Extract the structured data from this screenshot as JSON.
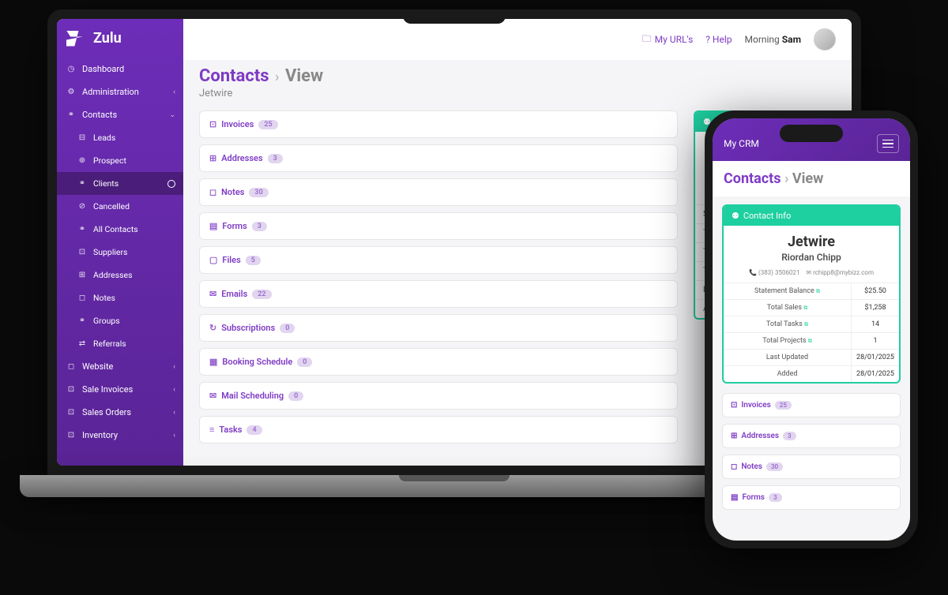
{
  "brand": "Zulu",
  "topbar": {
    "my_urls": "My URL's",
    "help": "? Help",
    "greeting_prefix": "Morning",
    "greeting_name": "Sam"
  },
  "page": {
    "section": "Contacts",
    "view": "View",
    "subtitle": "Jetwire"
  },
  "sidebar": {
    "items": [
      {
        "label": "Dashboard",
        "icon": "◷",
        "type": "main"
      },
      {
        "label": "Administration",
        "icon": "⚙",
        "type": "main",
        "chev": "‹"
      },
      {
        "label": "Contacts",
        "icon": "⚭",
        "type": "main",
        "chev": "⌄",
        "expanded": true
      },
      {
        "label": "Leads",
        "icon": "⊟",
        "type": "sub"
      },
      {
        "label": "Prospect",
        "icon": "⊕",
        "type": "sub"
      },
      {
        "label": "Clients",
        "icon": "⚭",
        "type": "sub",
        "active": true
      },
      {
        "label": "Cancelled",
        "icon": "⊘",
        "type": "sub"
      },
      {
        "label": "All Contacts",
        "icon": "⚭",
        "type": "sub"
      },
      {
        "label": "Suppliers",
        "icon": "⊡",
        "type": "sub"
      },
      {
        "label": "Addresses",
        "icon": "⊞",
        "type": "sub"
      },
      {
        "label": "Notes",
        "icon": "◻",
        "type": "sub"
      },
      {
        "label": "Groups",
        "icon": "⚭",
        "type": "sub"
      },
      {
        "label": "Referrals",
        "icon": "⇄",
        "type": "sub"
      },
      {
        "label": "Website",
        "icon": "◻",
        "type": "main",
        "chev": "‹"
      },
      {
        "label": "Sale Invoices",
        "icon": "⊡",
        "type": "main",
        "chev": "‹"
      },
      {
        "label": "Sales Orders",
        "icon": "⊡",
        "type": "main",
        "chev": "‹"
      },
      {
        "label": "Inventory",
        "icon": "⊡",
        "type": "main",
        "chev": "‹"
      }
    ]
  },
  "panels": [
    {
      "label": "Invoices",
      "count": "25",
      "icon": "⊡"
    },
    {
      "label": "Addresses",
      "count": "3",
      "icon": "⊞"
    },
    {
      "label": "Notes",
      "count": "30",
      "icon": "◻"
    },
    {
      "label": "Forms",
      "count": "3",
      "icon": "▤"
    },
    {
      "label": "Files",
      "count": "5",
      "icon": "▢"
    },
    {
      "label": "Emails",
      "count": "22",
      "icon": "✉"
    },
    {
      "label": "Subscriptions",
      "count": "0",
      "icon": "↻"
    },
    {
      "label": "Booking Schedule",
      "count": "0",
      "icon": "▦"
    },
    {
      "label": "Mail Scheduling",
      "count": "0",
      "icon": "✉"
    },
    {
      "label": "Tasks",
      "count": "4",
      "icon": "≡"
    }
  ],
  "contact_info": {
    "header": "Contact Info",
    "title": "Jetwire",
    "name": "Riordan Chipp",
    "phone": "(383) 3506021",
    "email": "rchipp8@mybizz.com",
    "rows": [
      {
        "label": "Statement Balance",
        "ext": true,
        "value": "$25.50"
      },
      {
        "label": "Total Sales",
        "ext": true,
        "value": "$1,258"
      },
      {
        "label": "Total Tasks",
        "ext": true,
        "value": "14"
      },
      {
        "label": "Total Projects",
        "ext": true,
        "value": "1"
      },
      {
        "label": "Last Updated",
        "ext": false,
        "value": "28/01/2025"
      },
      {
        "label": "Added",
        "ext": false,
        "value": "28/01/2025"
      }
    ]
  },
  "mobile": {
    "title": "My CRM",
    "panels": [
      {
        "label": "Invoices",
        "count": "25",
        "icon": "⊡"
      },
      {
        "label": "Addresses",
        "count": "3",
        "icon": "⊞"
      },
      {
        "label": "Notes",
        "count": "30",
        "icon": "◻"
      },
      {
        "label": "Forms",
        "count": "3",
        "icon": "▤"
      }
    ]
  }
}
